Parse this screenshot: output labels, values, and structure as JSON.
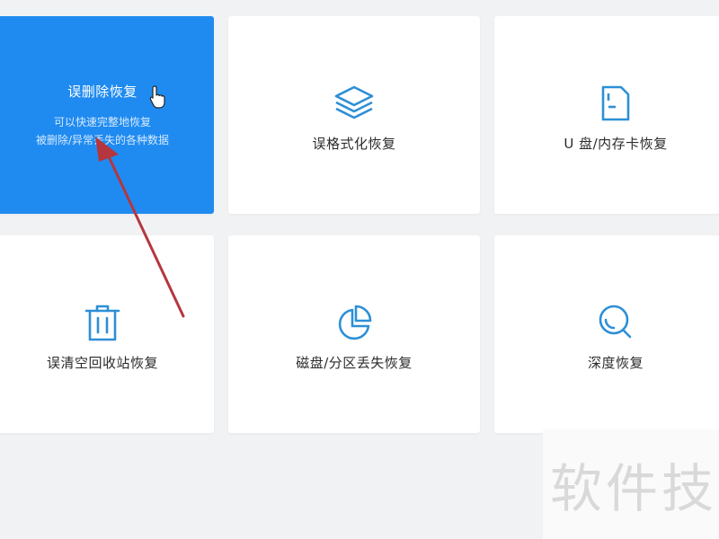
{
  "colors": {
    "accent": "#1f8bf0",
    "icon": "#2d8fd6",
    "card_bg": "#ffffff",
    "page_bg": "#f1f2f4",
    "arrow": "#b5363f"
  },
  "cards": [
    {
      "label": "误删除恢复",
      "desc_line1": "可以快速完整地恢复",
      "desc_line2": "被删除/异常丢失的各种数据",
      "active": true
    },
    {
      "label": "误格式化恢复",
      "icon": "layers-icon"
    },
    {
      "label": "U 盘/内存卡恢复",
      "icon": "sd-card-icon"
    },
    {
      "label": "误清空回收站恢复",
      "icon": "trash-icon"
    },
    {
      "label": "磁盘/分区丢失恢复",
      "icon": "pie-chart-icon"
    },
    {
      "label": "深度恢复",
      "icon": "magnifier-icon"
    }
  ],
  "watermark": {
    "text": "软件技"
  }
}
